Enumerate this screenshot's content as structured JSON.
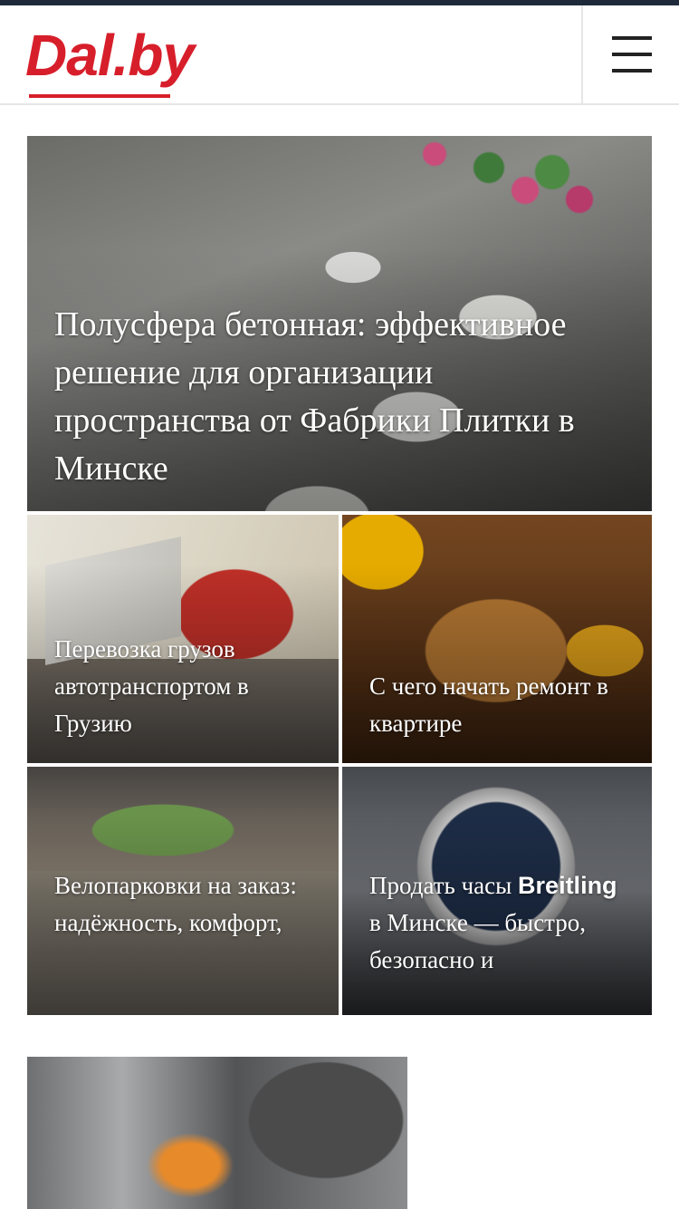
{
  "header": {
    "logo_text": "Dal.by",
    "brand_color": "#d71f2b",
    "menu_icon": "hamburger-menu-icon"
  },
  "articles": {
    "hero": {
      "title": "Полусфера бетонная: эффективное решение для организации пространства от Фабрики Плитки в Минске"
    },
    "trucks": {
      "title": "Перевозка грузов автотранспортом в Грузию"
    },
    "tools": {
      "title": "С чего начать ремонт в квартире"
    },
    "bikes": {
      "title": "Велопарковки на заказ: надёжность, комфорт,"
    },
    "watch": {
      "title_start": "Продать часы",
      "title_brand": "Breitling",
      "title_end": "в Минске — быстро, безопасно и"
    },
    "machine": {
      "title": ""
    }
  }
}
